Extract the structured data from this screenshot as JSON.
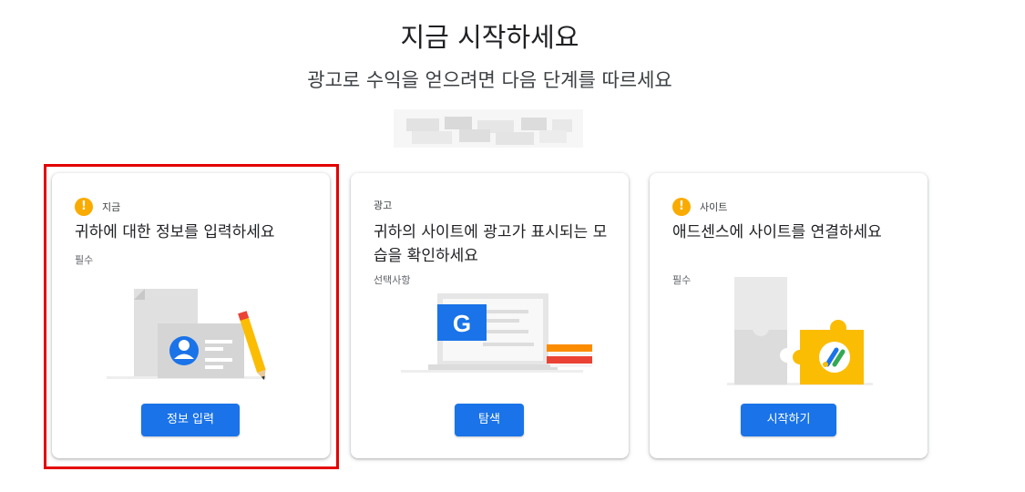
{
  "header": {
    "title": "지금 시작하세요",
    "subtitle": "광고로 수익을 얻으려면 다음 단계를 따르세요"
  },
  "cards": [
    {
      "tag": "지금",
      "has_warning": true,
      "title": "귀하에 대한 정보를 입력하세요",
      "status": "필수",
      "button": "정보 입력",
      "illustration": "profile-card-with-pencil"
    },
    {
      "tag": "광고",
      "has_warning": false,
      "title": "귀하의 사이트에 광고가 표시되는 모습을 확인하세요",
      "status": "선택사항",
      "button": "탐색",
      "illustration": "google-screen-with-books"
    },
    {
      "tag": "사이트",
      "has_warning": true,
      "title": "애드센스에 사이트를 연결하세요",
      "status": "필수",
      "button": "시작하기",
      "illustration": "puzzle-pieces-adsense"
    }
  ],
  "icons": {
    "warning": "!",
    "google_letter": "G"
  },
  "colors": {
    "primary_button": "#1a73e8",
    "warning": "#f9ab00",
    "highlight_box": "#e40000",
    "adsense_yellow": "#fbbc04"
  }
}
